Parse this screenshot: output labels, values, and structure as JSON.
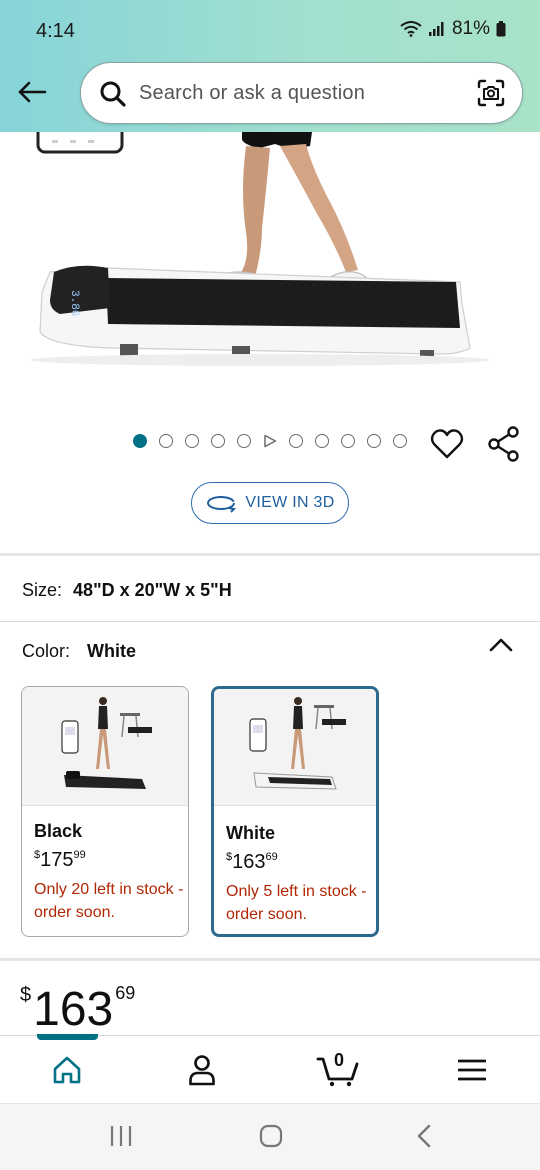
{
  "status_bar": {
    "time": "4:14",
    "battery": "81%"
  },
  "search": {
    "placeholder": "Search or ask a question"
  },
  "product_image": {
    "display_text": "3.86"
  },
  "carousel": {
    "dot_count": 11,
    "active_index": 0,
    "video_index": 5
  },
  "view3d": {
    "label": "VIEW IN 3D"
  },
  "size": {
    "label": "Size:",
    "value": "48\"D x 20\"W x 5\"H"
  },
  "color": {
    "label": "Color:",
    "value": "White"
  },
  "variants": [
    {
      "name": "Black",
      "currency": "$",
      "price_whole": "175",
      "price_fraction": "99",
      "stock": "Only 20 left in stock - order soon.",
      "selected": false
    },
    {
      "name": "White",
      "currency": "$",
      "price_whole": "163",
      "price_fraction": "69",
      "stock": "Only 5 left in stock - order soon.",
      "selected": true
    }
  ],
  "price": {
    "currency": "$",
    "whole": "163",
    "fraction": "69"
  },
  "bottom_nav": {
    "cart_count": "0",
    "items": [
      "home-icon",
      "account-icon",
      "cart-icon",
      "menu-icon"
    ]
  },
  "colors": {
    "header_gradient_start": "#86d4d8",
    "header_gradient_end": "#a8e3c8",
    "accent": "#007185",
    "stock_warning": "#b12704",
    "link_blue": "#1f5f9f"
  }
}
